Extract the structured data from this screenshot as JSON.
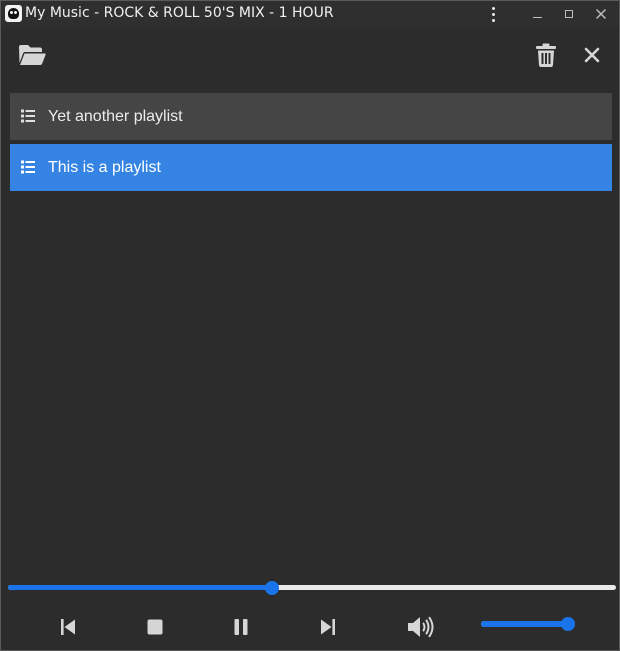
{
  "window": {
    "title": "My Music - ROCK & ROLL 50'S MIX - 1 HOUR",
    "app_icon": "skull-icon",
    "controls": {
      "menu_icon": "kebab-menu-icon",
      "minimize_icon": "minimize-icon",
      "maximize_icon": "maximize-icon",
      "close_icon": "close-icon"
    }
  },
  "toolbar": {
    "open_icon": "folder-open-icon",
    "delete_icon": "trash-icon",
    "close_icon": "close-icon"
  },
  "playlists": [
    {
      "label": "Yet another playlist",
      "icon": "list-icon",
      "selected": false
    },
    {
      "label": "This is a playlist",
      "icon": "list-icon",
      "selected": true
    }
  ],
  "player": {
    "progress_fraction": 0.435,
    "volume_fraction": 0.99,
    "controls": [
      "skip-previous-icon",
      "stop-icon",
      "pause-icon",
      "skip-next-icon",
      "volume-high-icon"
    ]
  },
  "colors": {
    "background": "#2c2c2c",
    "item_background": "#454545",
    "accent": "#3584e4",
    "slider_accent": "#1a73e8",
    "slider_track": "#e9e9e9",
    "icon": "#d6d6d6"
  }
}
